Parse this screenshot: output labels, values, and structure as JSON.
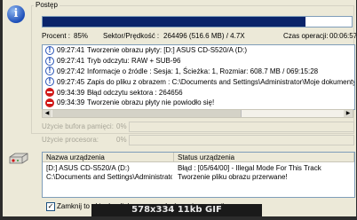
{
  "progress": {
    "group_label": "Postęp",
    "fill_fraction": 0.85,
    "procent_label": "Procent :",
    "procent_value": "85%",
    "sector_label": "Sektor/Prędkość :",
    "sector_value": "264496 (516.6 MB) / 4.7X",
    "time_label": "Czas operacji:",
    "time_value": "00:06:57"
  },
  "log": [
    {
      "icon": "info",
      "time": "09:27:41",
      "text": "Tworzenie obrazu płyty: [D:] ASUS CD-S520/A (D:)"
    },
    {
      "icon": "info",
      "time": "09:27:41",
      "text": "Tryb odczytu: RAW + SUB-96"
    },
    {
      "icon": "info",
      "time": "09:27:42",
      "text": "Informacje o źródle :  Sesja: 1, Ścieżka: 1, Rozmiar: 608.7 MB / 069:15:28"
    },
    {
      "icon": "info",
      "time": "09:27:45",
      "text": "Zapis do pliku z obrazem : C:\\Documents and Settings\\Administrator\\Moje dokumenty"
    },
    {
      "icon": "error",
      "time": "09:34:39",
      "text": "Błąd odczytu sektora : 264656"
    },
    {
      "icon": "error",
      "time": "09:34:39",
      "text": "Tworzenie obrazu płyty nie powiodło się!"
    }
  ],
  "usage": {
    "buffer_label": "Użycie bufora pamięci:",
    "buffer_value": "0%",
    "cpu_label": "Użycie procesora:",
    "cpu_value": "0%"
  },
  "devices": {
    "col_name": "Nazwa urządzenia",
    "col_status": "Status urządzenia",
    "rows": [
      {
        "name": "[D:] ASUS CD-S520/A (D:)",
        "status": "Błąd :   [05/64/00] - Illegal Mode For This Track"
      },
      {
        "name": "C:\\Documents and Settings\\Administrator\\...",
        "status": "Tworzenie pliku obrazu przerwane!"
      }
    ]
  },
  "close_checkbox": {
    "label": "Zamknij to okienko dialogowe po skończeniu operacji.",
    "checked": true
  },
  "caption": "578x334  11kb  GIF"
}
